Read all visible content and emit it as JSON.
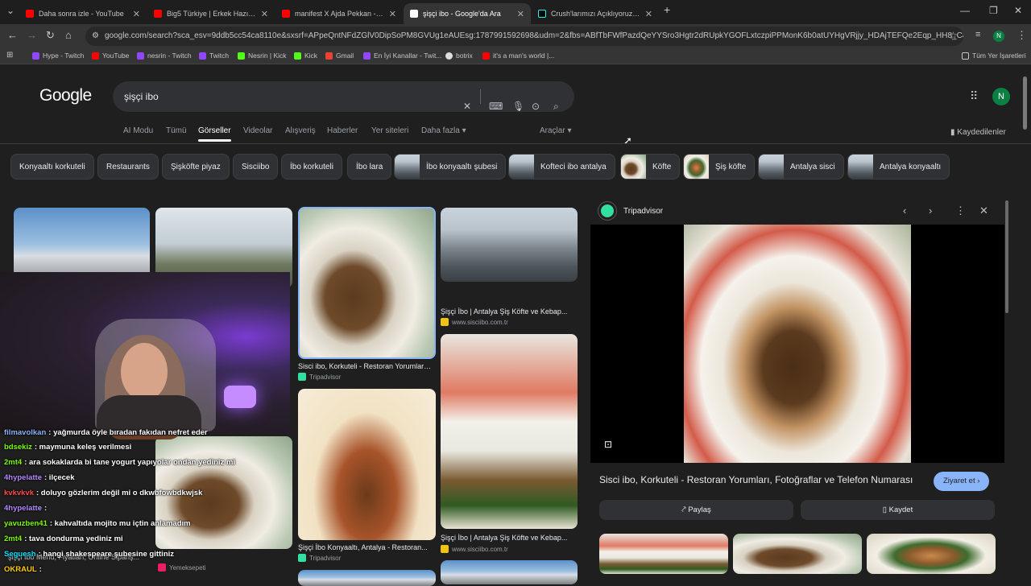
{
  "tabs": [
    {
      "title": "Daha sonra izle - YouTube",
      "icon": "youtube-icon"
    },
    {
      "title": "Big5 Türkiye | Erkek Hazırlık Se:",
      "icon": "youtube-icon"
    },
    {
      "title": "manifest X Ajda Pekkan - Hileli",
      "icon": "youtube-icon"
    },
    {
      "title": "şişçi ibo - Google'da Ara",
      "icon": "google-icon"
    },
    {
      "title": "Crush'larımızı Açıklıyoruz: İdol H",
      "icon": "tiktok-icon"
    }
  ],
  "address": {
    "domain": "google.com",
    "url": "google.com/search?sca_esv=9ddb5cc54ca8110e&sxsrf=APpeQntNFdZGlV0DipSoPM8GVUg1eAUEsg:1787991592698&udm=2&fbs=ABfTbFWfPazdQeYYSro3Hgtr2dRUpkYGOFLxtczpiPPMonK6b0atUYHgVRjjy_HDAjTEFQe2Eqp_HH8_C8qIZ-HeojriWNWo..."
  },
  "bookmarks": [
    "Hype - Twitch",
    "YouTube",
    "nesrin - Twitch",
    "Twitch",
    "Nesrin | Kick",
    "Kick",
    "Gmail",
    "En İyi Kanallar - Twit...",
    "botrix",
    "it's a man's world |..."
  ],
  "bookmarks_all": "Tüm Yer İşaretleri",
  "google": {
    "logo": "Google",
    "query": "şişçi ibo",
    "avatar": "N"
  },
  "nav_tabs": [
    "AI Modu",
    "Tümü",
    "Görseller",
    "Videolar",
    "Alışveriş",
    "Haberler",
    "Yer siteleri",
    "Daha fazla ▾"
  ],
  "tools": "Araçlar ▾",
  "saved": "Kaydedilenler",
  "chips": [
    "Konyaaltı korkuteli",
    "Restaurants",
    "Şişköfte piyaz",
    "Sisciibo",
    "İbo korkuteli",
    "İbo lara",
    "İbo konyaaltı şubesi",
    "Kofteci ibo antalya",
    "Köfte",
    "Şiş köfte",
    "Antalya sisci",
    "Antalya konyaaltı"
  ],
  "results": [
    {
      "caption": "Sisci ibo, Korkuteli - Restoran Yorumları,...",
      "source": "Tripadvisor"
    },
    {
      "caption": "Şişçi İbo | Antalya Şiş Köfte ve Kebap...",
      "source": "www.sisciibo.com.tr"
    },
    {
      "caption": "Şişçi İbo Konyaaltı, Antalya - Restoran...",
      "source": "Tripadvisor"
    },
    {
      "caption": "Şişçi İbo | Antalya Şiş Köfte ve Kebap...",
      "source": "www.sisciibo.com.tr"
    },
    {
      "caption": "şişçi İbo Menü, Fiyatları, Online Sipariş...",
      "source": "Yemeksepeti"
    }
  ],
  "panel": {
    "source": "Tripadvisor",
    "title": "Sisci ibo, Korkuteli - Restoran Yorumları, Fotoğraflar ve Telefon Numarası",
    "visit": "Ziyaret et ›",
    "share": "⤤ Paylaş",
    "save": "▯ Kaydet"
  },
  "chat": [
    {
      "user": "filmavolkan",
      "msg": ": yağmurda öyle bıradan fakıdan nefret eder",
      "color": "#8ab4f8"
    },
    {
      "user": "bdsekiz",
      "msg": ": maymuna keleş verilmesi",
      "color": "#7CFC00"
    },
    {
      "user": "2mt4",
      "msg": ": ara sokaklarda bi tane yogurt yapıyolar ondan yediniz mi",
      "color": "#7CFC00"
    },
    {
      "user": "4hypelatte",
      "msg": ": ilçecek",
      "color": "#b388ff"
    },
    {
      "user": "kvkvkvk",
      "msg": ": doluyo gözlerim değil mi o dkwbfowbdkwjsk",
      "color": "#ff4d4d"
    },
    {
      "user": "4hypelatte",
      "msg": ":",
      "color": "#b388ff"
    },
    {
      "user": "yavuzben41",
      "msg": ": kahvaltıda mojito mu içtin anlamadım",
      "color": "#7CFC00"
    },
    {
      "user": "2mt4",
      "msg": ": tava dondurma yediniz mi",
      "color": "#7CFC00"
    },
    {
      "user": "Seguesh",
      "msg": ": hangi shakespeare şubesine gittiniz",
      "color": "#00e5ff"
    },
    {
      "user": "OKRAUL",
      "msg": ":",
      "color": "#ffcc00"
    }
  ]
}
